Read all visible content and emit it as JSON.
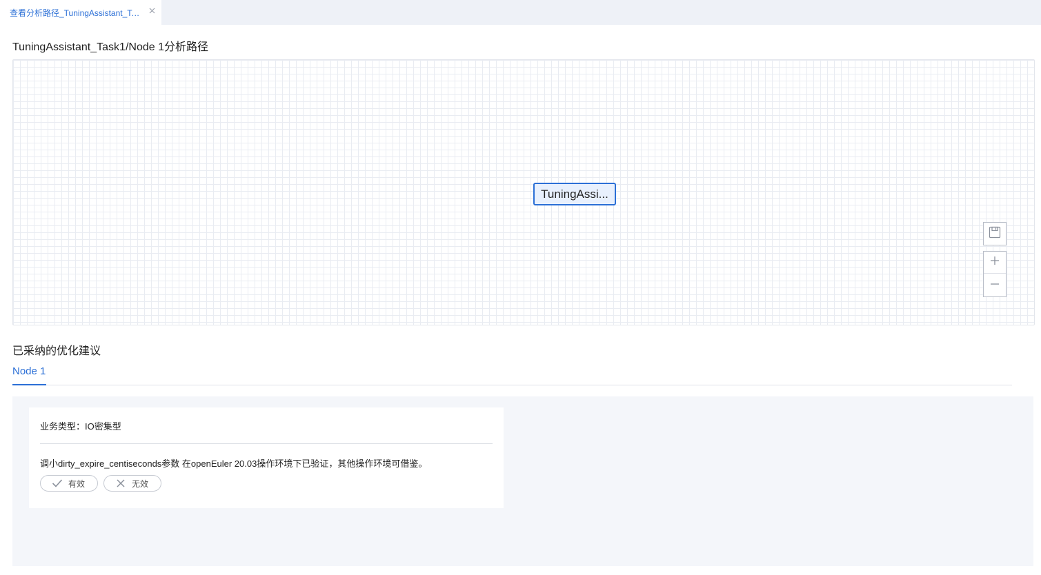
{
  "tab": {
    "label": "查看分析路径_TuningAssistant_Tas...",
    "close_icon": "close-icon"
  },
  "page": {
    "title": "TuningAssistant_Task1/Node 1分析路径"
  },
  "canvas": {
    "node_label": "TuningAssi...",
    "tools": {
      "save_icon": "save-icon",
      "zoom_in_icon": "plus-icon",
      "zoom_out_icon": "minus-icon"
    }
  },
  "adopted": {
    "section_title": "已采纳的优化建议",
    "tabs": [
      {
        "label": "Node 1",
        "active": true
      }
    ],
    "card": {
      "biz_type": "业务类型：IO密集型",
      "suggestion": "调小dirty_expire_centiseconds参数 在openEuler 20.03操作环境下已验证，其他操作环境可借鉴。",
      "valid_label": "有效",
      "invalid_label": "无效"
    }
  },
  "colors": {
    "accent": "#2b6fd6",
    "grid_line": "#e9ecf2",
    "panel_bg": "#f4f6fa"
  }
}
